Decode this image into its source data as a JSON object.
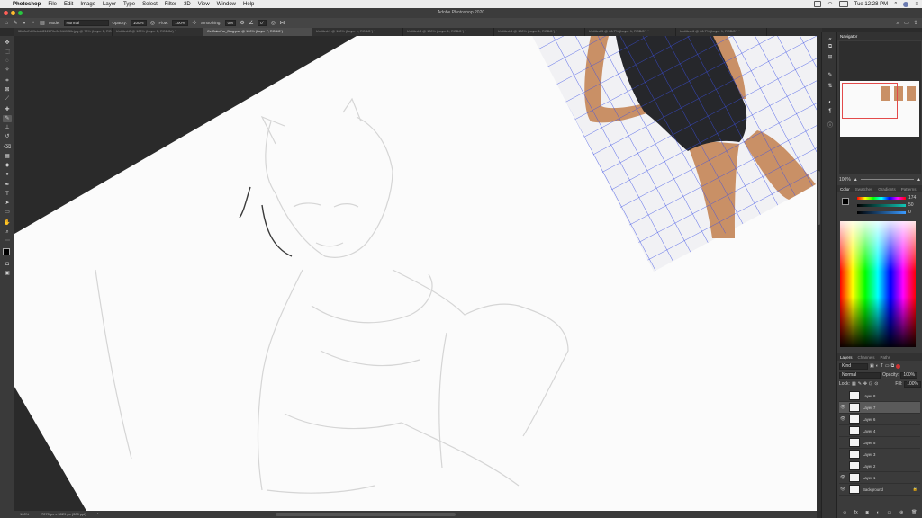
{
  "menubar": {
    "app": "Photoshop",
    "items": [
      "File",
      "Edit",
      "Image",
      "Layer",
      "Type",
      "Select",
      "Filter",
      "3D",
      "View",
      "Window",
      "Help"
    ],
    "clock": "Tue 12:28 PM"
  },
  "window": {
    "title": "Adobe Photoshop 2020"
  },
  "options": {
    "mode_label": "Mode:",
    "mode_value": "Normal",
    "opacity_label": "Opacity:",
    "opacity_value": "100%",
    "flow_label": "Flow:",
    "flow_value": "100%",
    "smoothing_label": "Smoothing:",
    "smoothing_value": "0%",
    "angle_value": "0°"
  },
  "tabs": [
    {
      "label": "f8fa0a7d09ebdd212870e0e9449f5fb.jpg @ 70% (Layer 1, RGB/8#)"
    },
    {
      "label": "Untitled-2 @ 100% (Layer 1, RGB/8#) *"
    },
    {
      "label": "CelCakeFur_Blog.psd @ 100% (Layer 7, RGB/8*)",
      "active": true
    },
    {
      "label": "Untitled-1 @ 100% (Layer 1, RGB/8*) *"
    },
    {
      "label": "Untitled-3 @ 100% (Layer 1, RGB/8*) *"
    },
    {
      "label": "Untitled-4 @ 100% (Layer 1, RGB/8*) *"
    },
    {
      "label": "Untitled-5 @ 66.7% (Layer 1, RGB/8*) *"
    },
    {
      "label": "Untitled-6 @ 66.7% (Layer 1, RGB/8*) *"
    }
  ],
  "status": {
    "zoom": "100%",
    "doc_size": "7270 px x 5029 px (300 ppi)"
  },
  "navigator": {
    "tab": "Navigator",
    "zoom": "100%"
  },
  "color": {
    "tabs": [
      "Color",
      "Swatches",
      "Gradients",
      "Patterns"
    ],
    "h_value": "174",
    "s_value": "50",
    "b_value": "0",
    "foreground": "#000000",
    "background": "#ffffff"
  },
  "layers": {
    "tabs": [
      "Layers",
      "Channels",
      "Paths"
    ],
    "kind_label": "Kind",
    "blend_mode": "Normal",
    "opacity_label": "Opacity:",
    "opacity_value": "100%",
    "lock_label": "Lock:",
    "fill_label": "Fill:",
    "fill_value": "100%",
    "items": [
      {
        "name": "Layer 8",
        "visible": false,
        "selected": false
      },
      {
        "name": "Layer 7",
        "visible": true,
        "selected": true
      },
      {
        "name": "Layer 6",
        "visible": true,
        "selected": false
      },
      {
        "name": "Layer 4",
        "visible": false,
        "selected": false
      },
      {
        "name": "Layer 5",
        "visible": false,
        "selected": false
      },
      {
        "name": "Layer 3",
        "visible": false,
        "selected": false
      },
      {
        "name": "Layer 2",
        "visible": false,
        "selected": false
      },
      {
        "name": "Layer 1",
        "visible": true,
        "selected": false
      },
      {
        "name": "Background",
        "visible": true,
        "selected": false
      }
    ]
  },
  "colors": {
    "grid_line": "#3a4fe6",
    "swimsuit": "#26272b",
    "skin": "#c99066"
  }
}
